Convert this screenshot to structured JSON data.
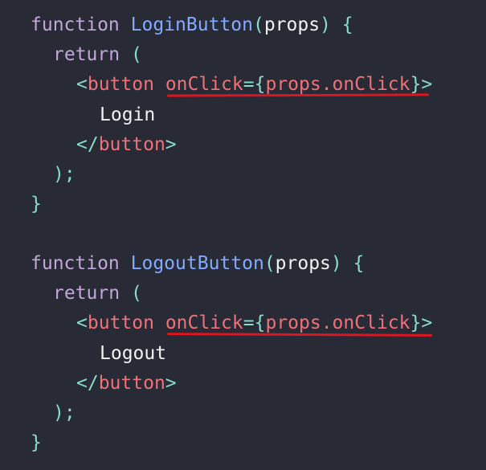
{
  "colors": {
    "background": "#282a36",
    "keyword": "#c3a6d8",
    "function_name": "#82aaff",
    "parameter": "#f2f2f2",
    "punctuation": "#89ddca",
    "tag": "#f07178",
    "text": "#f2f2f2",
    "highlight_underline": "#e0141e"
  },
  "code": {
    "login": {
      "keyword": "function",
      "name": "LoginButton",
      "open_paren": "(",
      "param": "props",
      "close_paren": ")",
      "open_brace": "{",
      "return_kw": "return",
      "return_paren": "(",
      "tag_open_lt": "<",
      "tag_name": "button",
      "attr_name": "onClick",
      "attr_eq": "=",
      "expr_open": "{",
      "expr": "props.onClick",
      "expr_close": "}",
      "tag_open_gt": ">",
      "label": "Login",
      "close_tag_lt": "</",
      "close_tag_name": "button",
      "close_tag_gt": ">",
      "close_return": ");",
      "close_brace": "}"
    },
    "logout": {
      "keyword": "function",
      "name": "LogoutButton",
      "open_paren": "(",
      "param": "props",
      "close_paren": ")",
      "open_brace": "{",
      "return_kw": "return",
      "return_paren": "(",
      "tag_open_lt": "<",
      "tag_name": "button",
      "attr_name": "onClick",
      "attr_eq": "=",
      "expr_open": "{",
      "expr": "props.onClick",
      "expr_close": "}",
      "tag_open_gt": ">",
      "label": "Logout",
      "close_tag_lt": "</",
      "close_tag_name": "button",
      "close_tag_gt": ">",
      "close_return": ");",
      "close_brace": "}"
    }
  }
}
